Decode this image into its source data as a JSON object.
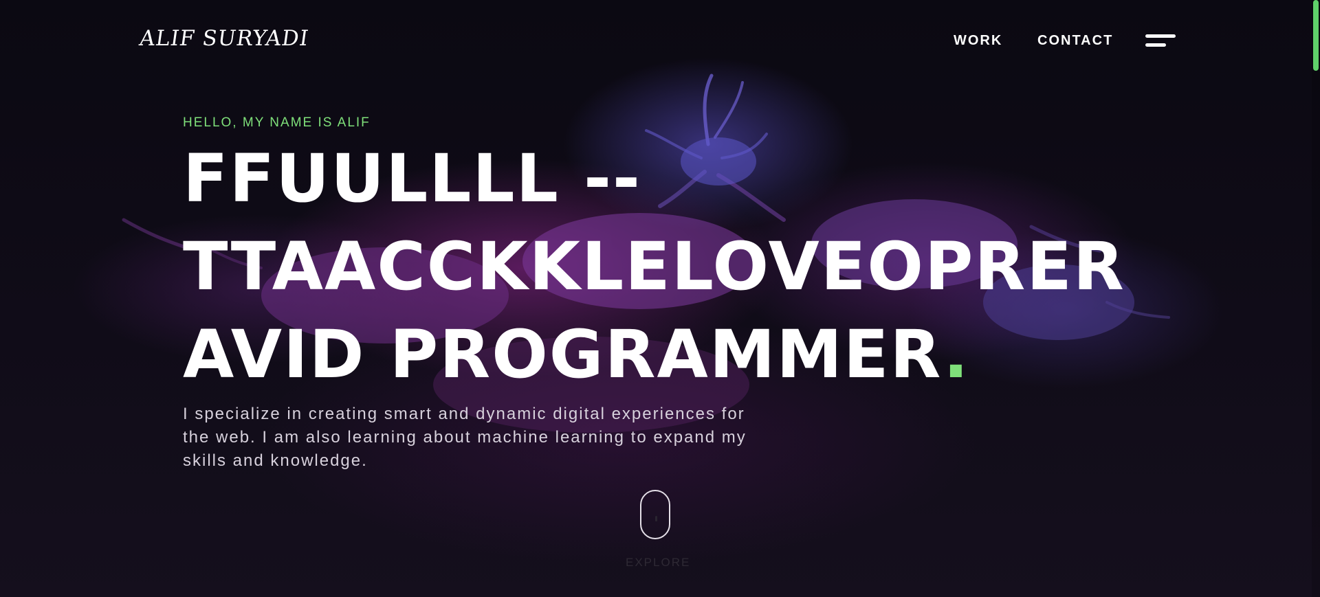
{
  "header": {
    "logo": "ALIF SURYADI",
    "nav": [
      "WORK",
      "CONTACT"
    ],
    "menu_icon": "hamburger-menu-icon"
  },
  "hero": {
    "eyebrow": "HELLO, MY NAME IS ALIF",
    "headline_lines": [
      "FFUULLLL --",
      "TTAACCKKLELOVEOPRER",
      "AVID PROGRAMMER"
    ],
    "headline_dot": ".",
    "intro_lines": [
      "I specialize in creating smart and dynamic digital experiences for",
      "the web. I am also learning about machine learning to expand my",
      "skills and knowledge."
    ]
  },
  "scroll_indicator": {
    "label": "EXPLORE",
    "icon": "mouse-scroll-icon"
  },
  "colors": {
    "background": "#0d0a14",
    "accent": "#7fe07a",
    "text": "#ffffff",
    "muted_text": "#d7d1dc",
    "scrollbar_thumb": "#5fd06a"
  }
}
